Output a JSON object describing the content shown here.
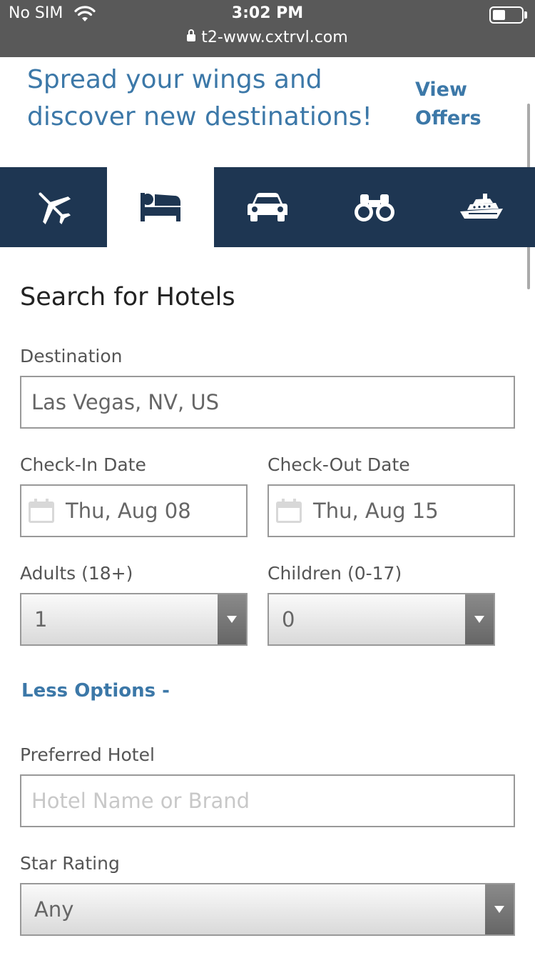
{
  "status_bar": {
    "carrier": "No SIM",
    "time": "3:02 PM",
    "url": "t2-www.cxtrvl.com"
  },
  "promo": {
    "headline": "Spread your wings and discover new destinations!",
    "link": "View Offers"
  },
  "tabs": [
    {
      "icon": "airplane-icon",
      "active": false
    },
    {
      "icon": "bed-icon",
      "active": true
    },
    {
      "icon": "car-icon",
      "active": false
    },
    {
      "icon": "binoculars-icon",
      "active": false
    },
    {
      "icon": "cruise-ship-icon",
      "active": false
    }
  ],
  "form": {
    "title": "Search for Hotels",
    "destination": {
      "label": "Destination",
      "value": "Las Vegas, NV, US"
    },
    "check_in": {
      "label": "Check-In Date",
      "value": "Thu, Aug 08"
    },
    "check_out": {
      "label": "Check-Out Date",
      "value": "Thu, Aug 15"
    },
    "adults": {
      "label": "Adults (18+)",
      "value": "1"
    },
    "children": {
      "label": "Children (0-17)",
      "value": "0"
    },
    "less_options": "Less Options -",
    "preferred_hotel": {
      "label": "Preferred Hotel",
      "placeholder": "Hotel Name or Brand"
    },
    "star_rating": {
      "label": "Star Rating",
      "value": "Any"
    }
  },
  "colors": {
    "nav_bg": "#1e3652",
    "link": "#3c78a8",
    "status_bar": "#595959"
  }
}
